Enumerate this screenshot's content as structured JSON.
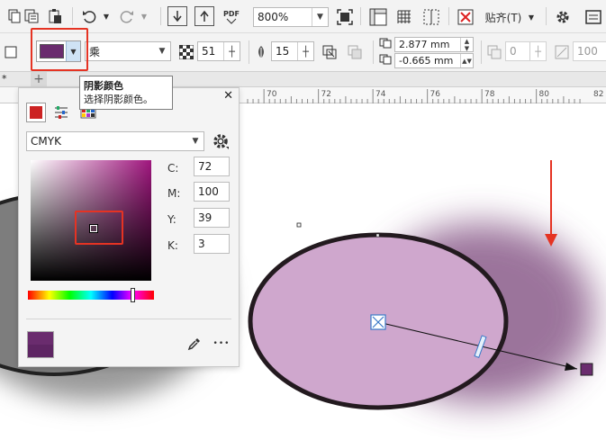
{
  "toolbar": {
    "zoom_value": "800%",
    "snap_label": "贴齐(T)",
    "pdf_label": "PDF"
  },
  "property_bar": {
    "shadow_color": "#6a2c6e",
    "merge_mode": "乘",
    "opacity": "51",
    "feather": "15",
    "offset_x": "2.877 mm",
    "offset_y": "-0.665 mm",
    "fade": "0",
    "stretch": "100"
  },
  "tooltip": {
    "title": "阴影颜色",
    "description": "选择阴影颜色。"
  },
  "tab": {
    "star": "*",
    "plus": "+"
  },
  "ruler": {
    "ticks": [
      "70",
      "72",
      "74",
      "76",
      "78",
      "80",
      "82"
    ]
  },
  "color_panel": {
    "model": "CMYK",
    "c_label": "C:",
    "m_label": "M:",
    "y_label": "Y:",
    "k_label": "K:",
    "c": "72",
    "m": "100",
    "y": "39",
    "k": "3",
    "current_color": "#6a2c6e",
    "close": "✕",
    "more": "•••"
  },
  "colors": {
    "accent_red": "#e53323",
    "ellipse_fill": "#cfa7cd",
    "shadow_purple": "#8a5c8a"
  }
}
